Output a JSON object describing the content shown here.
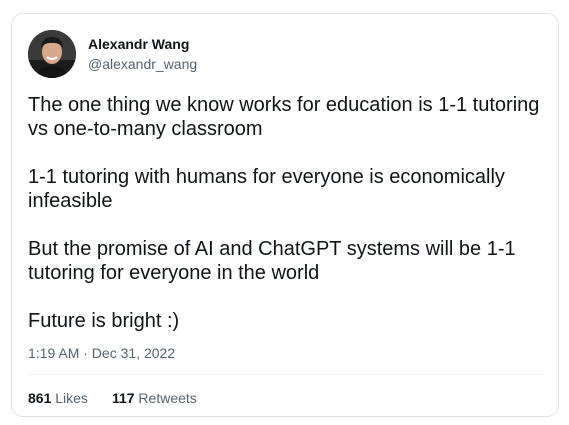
{
  "tweet": {
    "author": {
      "display_name": "Alexandr Wang",
      "handle": "@alexandr_wang",
      "avatar_icon": "profile-photo"
    },
    "paragraphs": [
      "The one thing we know works for education is 1-1 tutoring vs one-to-many classroom",
      "1-1 tutoring with humans for everyone is economically infeasible",
      "But the promise of AI and ChatGPT systems will be 1-1 tutoring for everyone in the world",
      "Future is bright :)"
    ],
    "timestamp": "1:19 AM · Dec 31, 2022",
    "stats": {
      "likes_count": "861",
      "likes_label": "Likes",
      "retweets_count": "117",
      "retweets_label": "Retweets"
    }
  },
  "colors": {
    "text_primary": "#0f1419",
    "text_secondary": "#536471",
    "border": "#dfe3e6",
    "divider": "#eff3f4"
  }
}
